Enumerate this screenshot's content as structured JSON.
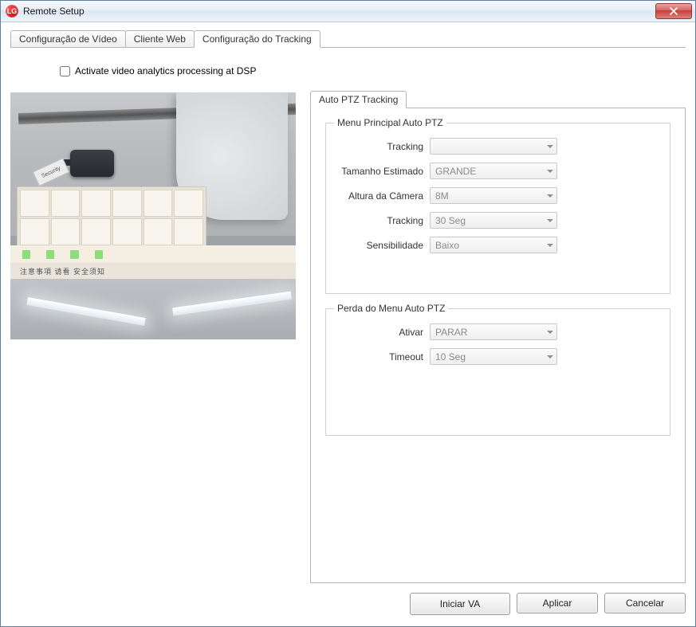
{
  "window": {
    "title": "Remote Setup"
  },
  "tabs": [
    {
      "label": "Configuração de Vídeo",
      "active": false
    },
    {
      "label": "Cliente Web",
      "active": false
    },
    {
      "label": "Configuração do Tracking",
      "active": true
    }
  ],
  "checkbox": {
    "label": "Activate video analytics processing at DSP",
    "checked": false
  },
  "inner_tab": {
    "label": "Auto PTZ Tracking"
  },
  "group1": {
    "title": "Menu Principal Auto PTZ",
    "fields": {
      "tracking1_label": "Tracking",
      "tracking1_value": "",
      "tamanho_label": "Tamanho Estimado",
      "tamanho_value": "GRANDE",
      "altura_label": "Altura da Câmera",
      "altura_value": "8M",
      "tracking2_label": "Tracking",
      "tracking2_value": "30 Seg",
      "sensibilidade_label": "Sensibilidade",
      "sensibilidade_value": "Baixo"
    }
  },
  "group2": {
    "title": "Perda do Menu Auto PTZ",
    "fields": {
      "ativar_label": "Ativar",
      "ativar_value": "PARAR",
      "timeout_label": "Timeout",
      "timeout_value": "10 Seg"
    }
  },
  "buttons": {
    "iniciar": "Iniciar VA",
    "aplicar": "Aplicar",
    "cancelar": "Cancelar"
  },
  "preview": {
    "security_label": "Security"
  }
}
